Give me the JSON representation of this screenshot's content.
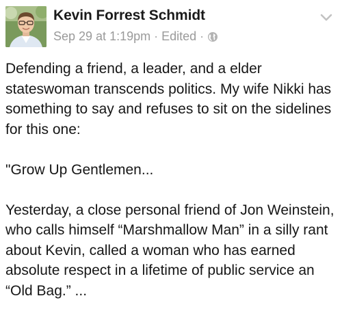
{
  "post": {
    "author": "Kevin Forrest Schmidt",
    "timestamp": "Sep 29 at 1:19pm",
    "edited_label": "Edited",
    "separator": "·",
    "privacy_icon": "globe-icon",
    "menu_icon": "chevron-down-icon",
    "paragraphs": [
      "Defending a friend, a leader, and a elder stateswoman transcends politics. My wife Nikki has something to say and refuses to sit on the sidelines for this one:",
      "\"Grow Up Gentlemen...",
      "Yesterday, a close personal friend of Jon Weinstein, who calls himself “Marshmallow Man” in a silly rant about Kevin, called a woman who has earned absolute respect in a lifetime of public service an “Old Bag.” ..."
    ]
  },
  "colors": {
    "author_text": "#1a1a1a",
    "meta_text": "#9a9a9a",
    "body_text": "#161616",
    "background": "#ffffff"
  }
}
